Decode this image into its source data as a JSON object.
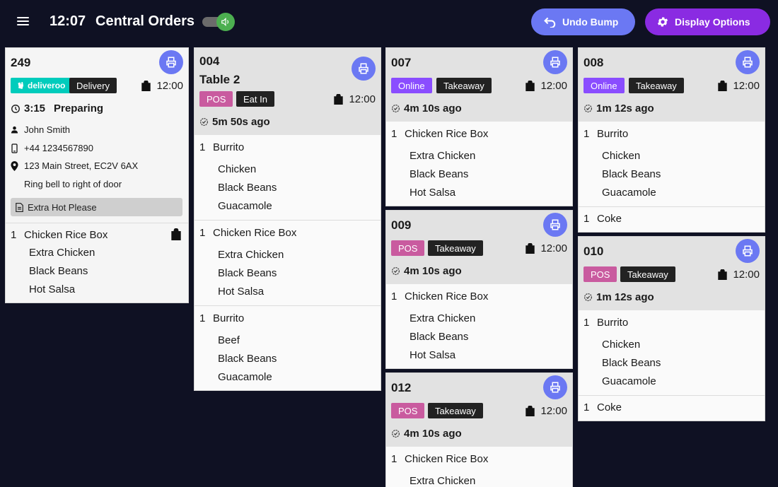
{
  "header": {
    "time": "12:07",
    "title": "Central Orders",
    "undo_label": "Undo Bump",
    "display_label": "Display Options"
  },
  "orders": {
    "o249": {
      "number": "249",
      "brand": "deliveroo",
      "type": "Delivery",
      "due": "12:00",
      "timer": "3:15",
      "status": "Preparing",
      "customer": "John Smith",
      "phone": "+44 1234567890",
      "address": "123 Main Street, EC2V 6AX",
      "instructions": "Ring bell to right of door",
      "note": "Extra Hot Please",
      "items": [
        {
          "qty": "1",
          "name": "Chicken Rice Box",
          "mods": [
            "Extra Chicken",
            "Black Beans",
            "Hot Salsa"
          ]
        }
      ]
    },
    "o004": {
      "number": "004",
      "table": "Table 2",
      "source": "POS",
      "type": "Eat In",
      "due": "12:00",
      "ago": "5m 50s ago",
      "items": [
        {
          "qty": "1",
          "name": "Burrito",
          "mods": [
            "Chicken",
            "Black Beans",
            "Guacamole"
          ]
        },
        {
          "qty": "1",
          "name": "Chicken Rice Box",
          "mods": [
            "Extra Chicken",
            "Black Beans",
            "Hot Salsa"
          ]
        },
        {
          "qty": "1",
          "name": "Burrito",
          "mods": [
            "Beef",
            "Black Beans",
            "Guacamole"
          ]
        }
      ]
    },
    "o007": {
      "number": "007",
      "source": "Online",
      "type": "Takeaway",
      "due": "12:00",
      "ago": "4m 10s ago",
      "items": [
        {
          "qty": "1",
          "name": "Chicken Rice Box",
          "mods": [
            "Extra Chicken",
            "Black Beans",
            "Hot Salsa"
          ]
        }
      ]
    },
    "o009": {
      "number": "009",
      "source": "POS",
      "type": "Takeaway",
      "due": "12:00",
      "ago": "4m 10s ago",
      "items": [
        {
          "qty": "1",
          "name": "Chicken Rice Box",
          "mods": [
            "Extra Chicken",
            "Black Beans",
            "Hot Salsa"
          ]
        }
      ]
    },
    "o012": {
      "number": "012",
      "source": "POS",
      "type": "Takeaway",
      "due": "12:00",
      "ago": "4m 10s ago",
      "items": [
        {
          "qty": "1",
          "name": "Chicken Rice Box",
          "mods": [
            "Extra Chicken"
          ]
        }
      ]
    },
    "o008": {
      "number": "008",
      "source": "Online",
      "type": "Takeaway",
      "due": "12:00",
      "ago": "1m 12s ago",
      "items": [
        {
          "qty": "1",
          "name": "Burrito",
          "mods": [
            "Chicken",
            "Black Beans",
            "Guacamole"
          ]
        },
        {
          "qty": "1",
          "name": "Coke",
          "mods": []
        }
      ]
    },
    "o010": {
      "number": "010",
      "source": "POS",
      "type": "Takeaway",
      "due": "12:00",
      "ago": "1m 12s ago",
      "items": [
        {
          "qty": "1",
          "name": "Burrito",
          "mods": [
            "Chicken",
            "Black Beans",
            "Guacamole"
          ]
        },
        {
          "qty": "1",
          "name": "Coke",
          "mods": []
        }
      ]
    }
  },
  "icons": {
    "menu": "menu-icon",
    "sound": "speaker-icon",
    "undo": "undo-icon",
    "settings": "gear-icon",
    "print": "printer-icon",
    "bag": "bag-icon",
    "clock": "clock-icon",
    "check": "check-clock-icon",
    "person": "person-icon",
    "phone": "phone-icon",
    "pin": "pin-icon",
    "note": "note-icon"
  },
  "colors": {
    "background": "#0f1123",
    "accent": "#6b78f3",
    "purple": "#8a2be2",
    "online": "#8a4dff",
    "pos": "#c95b9f",
    "deliveroo": "#00ccbc",
    "sound_on": "#4caf50"
  }
}
